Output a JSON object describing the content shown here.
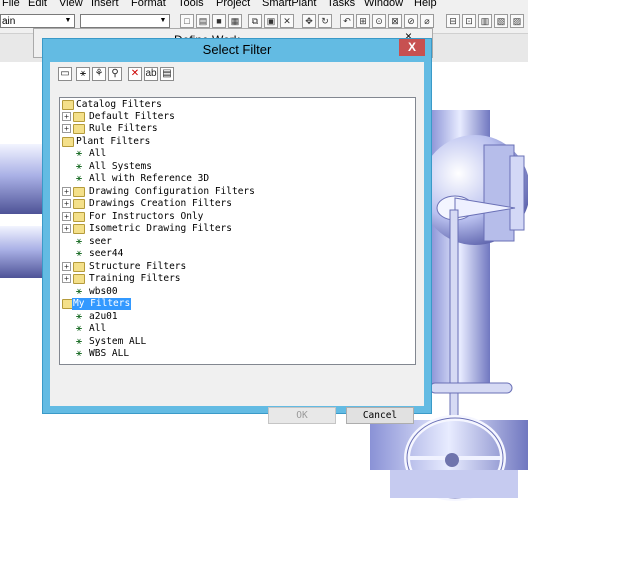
{
  "menu": [
    "File",
    "Edit",
    "View",
    "Insert",
    "Format",
    "Tools",
    "Project",
    "SmartPlant",
    "Tasks",
    "Window",
    "Help"
  ],
  "toolbar": {
    "combo1_value": "ain",
    "combo2_value": ""
  },
  "background_window": {
    "title": "Define Work...",
    "close": "×"
  },
  "dialog": {
    "title": "Select Filter",
    "close_label": "X",
    "ok_label": "OK",
    "cancel_label": "Cancel"
  },
  "tree": {
    "catalog_filters": "Catalog Filters",
    "default_filters": "Default Filters",
    "rule_filters": "Rule Filters",
    "plant_filters": "Plant Filters",
    "all": "All",
    "all_systems": "All Systems",
    "all_with_ref_3d": "All with Reference 3D",
    "drawing_config_filters": "Drawing Configuration Filters",
    "drawings_creation_filters": "Drawings Creation Filters",
    "for_instructors_only": "For Instructors Only",
    "isometric_drawing_filters": "Isometric Drawing Filters",
    "seer": "seer",
    "seer44": "seer44",
    "structure_filters": "Structure Filters",
    "training_filters": "Training Filters",
    "wbs00": "wbs00",
    "my_filters": "My Filters",
    "a2u01": "a2u01",
    "my_all": "All",
    "system_all": "System ALL",
    "wbs_all": "WBS ALL"
  },
  "colors": {
    "dialog_frame": "#63bbe3",
    "close_button": "#c75050",
    "selection": "#3399ff"
  }
}
